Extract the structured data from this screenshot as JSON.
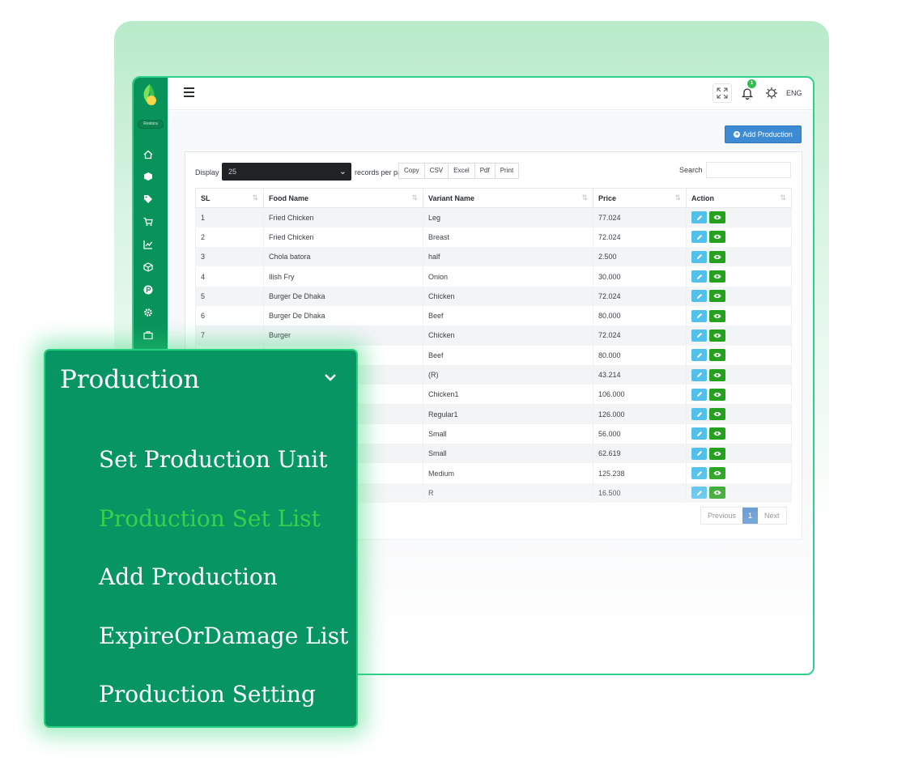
{
  "topbar": {
    "notification_count": "1",
    "language": "ENG"
  },
  "sidebar": {
    "logo_text": "Restora",
    "items": [
      "home-icon",
      "cube-icon",
      "tags-icon",
      "cart-icon",
      "chart-icon",
      "box-icon",
      "p-circle-icon",
      "gear-icon",
      "briefcase-icon"
    ]
  },
  "toolbar": {
    "add_production_label": "Add Production"
  },
  "table_controls": {
    "display_label": "Display",
    "page_size": "25",
    "records_label": "records per page",
    "export_buttons": [
      "Copy",
      "CSV",
      "Excel",
      "Pdf",
      "Print"
    ],
    "search_label": "Search"
  },
  "table": {
    "columns": [
      "SL",
      "Food Name",
      "Variant Name",
      "Price",
      "Action"
    ],
    "rows": [
      [
        "1",
        "Fried Chicken",
        "Leg",
        "77.024"
      ],
      [
        "2",
        "Fried Chicken",
        "Breast",
        "72.024"
      ],
      [
        "3",
        "Chola batora",
        "half",
        "2.500"
      ],
      [
        "4",
        "Ilish Fry",
        "Onion",
        "30.000"
      ],
      [
        "5",
        "Burger De Dhaka",
        "Chicken",
        "72.024"
      ],
      [
        "6",
        "Burger De Dhaka",
        "Beef",
        "80.000"
      ],
      [
        "7",
        "Burger",
        "Chicken",
        "72.024"
      ],
      [
        "",
        "",
        "Beef",
        "80.000"
      ],
      [
        "",
        "",
        "(R)",
        "43.214"
      ],
      [
        "",
        "",
        "Chicken1",
        "106.000"
      ],
      [
        "",
        "",
        "Regular1",
        "126.000"
      ],
      [
        "",
        "",
        "Small",
        "56.000"
      ],
      [
        "",
        "",
        "Small",
        "62.619"
      ],
      [
        "",
        "",
        "Medium",
        "125.238"
      ],
      [
        "",
        "",
        "R",
        "16.500"
      ]
    ]
  },
  "pagination": {
    "previous": "Previous",
    "current": "1",
    "next": "Next"
  },
  "menu": {
    "title": "Production",
    "items": [
      "Set Production Unit",
      "Production Set List",
      "Add Production",
      "ExpireOrDamage List",
      "Production Setting"
    ],
    "active_index": 1
  },
  "colors": {
    "sidebar": "#08935a",
    "menu_bg": "#069563",
    "active_item": "#3ad14a",
    "primary_button": "#3d8bd3",
    "view_button": "#26a11f",
    "edit_button": "#52c0e8"
  }
}
